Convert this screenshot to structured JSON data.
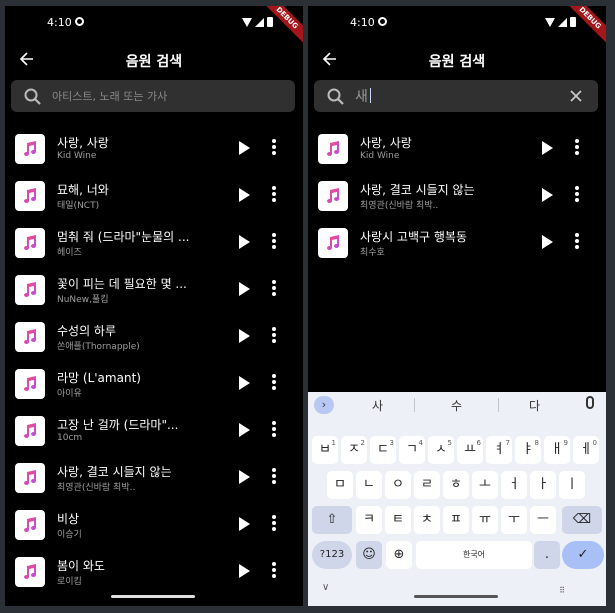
{
  "status": {
    "time": "4:10",
    "debug": "DEBUG"
  },
  "appbar": {
    "title": "음원 검색"
  },
  "left": {
    "search_placeholder": "아티스트, 노래 또는 가사",
    "results": [
      {
        "title": "사랑, 사랑",
        "artist": "Kid Wine"
      },
      {
        "title": "묘해, 너와",
        "artist": "태일(NCT)"
      },
      {
        "title": "멈춰 줘 (드라마\"눈물의 ...",
        "artist": "헤이즈"
      },
      {
        "title": "꽃이 피는 데 필요한 몇 ...",
        "artist": "NuNew,풀킴"
      },
      {
        "title": "수성의 하루",
        "artist": "쏜애플(Thornapple)"
      },
      {
        "title": "라망 (L'amant)",
        "artist": "아이유"
      },
      {
        "title": "고장 난 걸까 (드라마\"...",
        "artist": "10cm"
      },
      {
        "title": "사랑, 결코 시들지 않는",
        "artist": "최영관(신바람 최박.."
      },
      {
        "title": "비상",
        "artist": "이승기"
      },
      {
        "title": "봄이 와도",
        "artist": "로이킴"
      }
    ]
  },
  "right": {
    "search_value": "새",
    "results": [
      {
        "title": "사랑, 사랑",
        "artist": "Kid Wine"
      },
      {
        "title": "사랑, 결코 시들지 않는",
        "artist": "최영관(신바람 최박.."
      },
      {
        "title": "사랑시 고백구 행복동",
        "artist": "최수호"
      }
    ]
  },
  "keyboard": {
    "suggestions": [
      "사",
      "수",
      "다"
    ],
    "row1": [
      {
        "k": "ㅂ",
        "s": "1"
      },
      {
        "k": "ㅈ",
        "s": "2"
      },
      {
        "k": "ㄷ",
        "s": "3"
      },
      {
        "k": "ㄱ",
        "s": "4"
      },
      {
        "k": "ㅅ",
        "s": "5"
      },
      {
        "k": "ㅛ",
        "s": "6"
      },
      {
        "k": "ㅕ",
        "s": "7"
      },
      {
        "k": "ㅑ",
        "s": "8"
      },
      {
        "k": "ㅐ",
        "s": "9"
      },
      {
        "k": "ㅔ",
        "s": "0"
      }
    ],
    "row2": [
      "ㅁ",
      "ㄴ",
      "ㅇ",
      "ㄹ",
      "ㅎ",
      "ㅗ",
      "ㅓ",
      "ㅏ",
      "ㅣ"
    ],
    "row3": [
      "ㅋ",
      "ㅌ",
      "ㅊ",
      "ㅍ",
      "ㅠ",
      "ㅜ",
      "ㅡ"
    ],
    "sym_label": "?123",
    "emoji": "☺",
    "space_label": "한국어",
    "period": ".",
    "enter_icon": "✓",
    "shift_icon": "⇧",
    "backspace_icon": "⌫",
    "globe_icon": "⊕"
  }
}
